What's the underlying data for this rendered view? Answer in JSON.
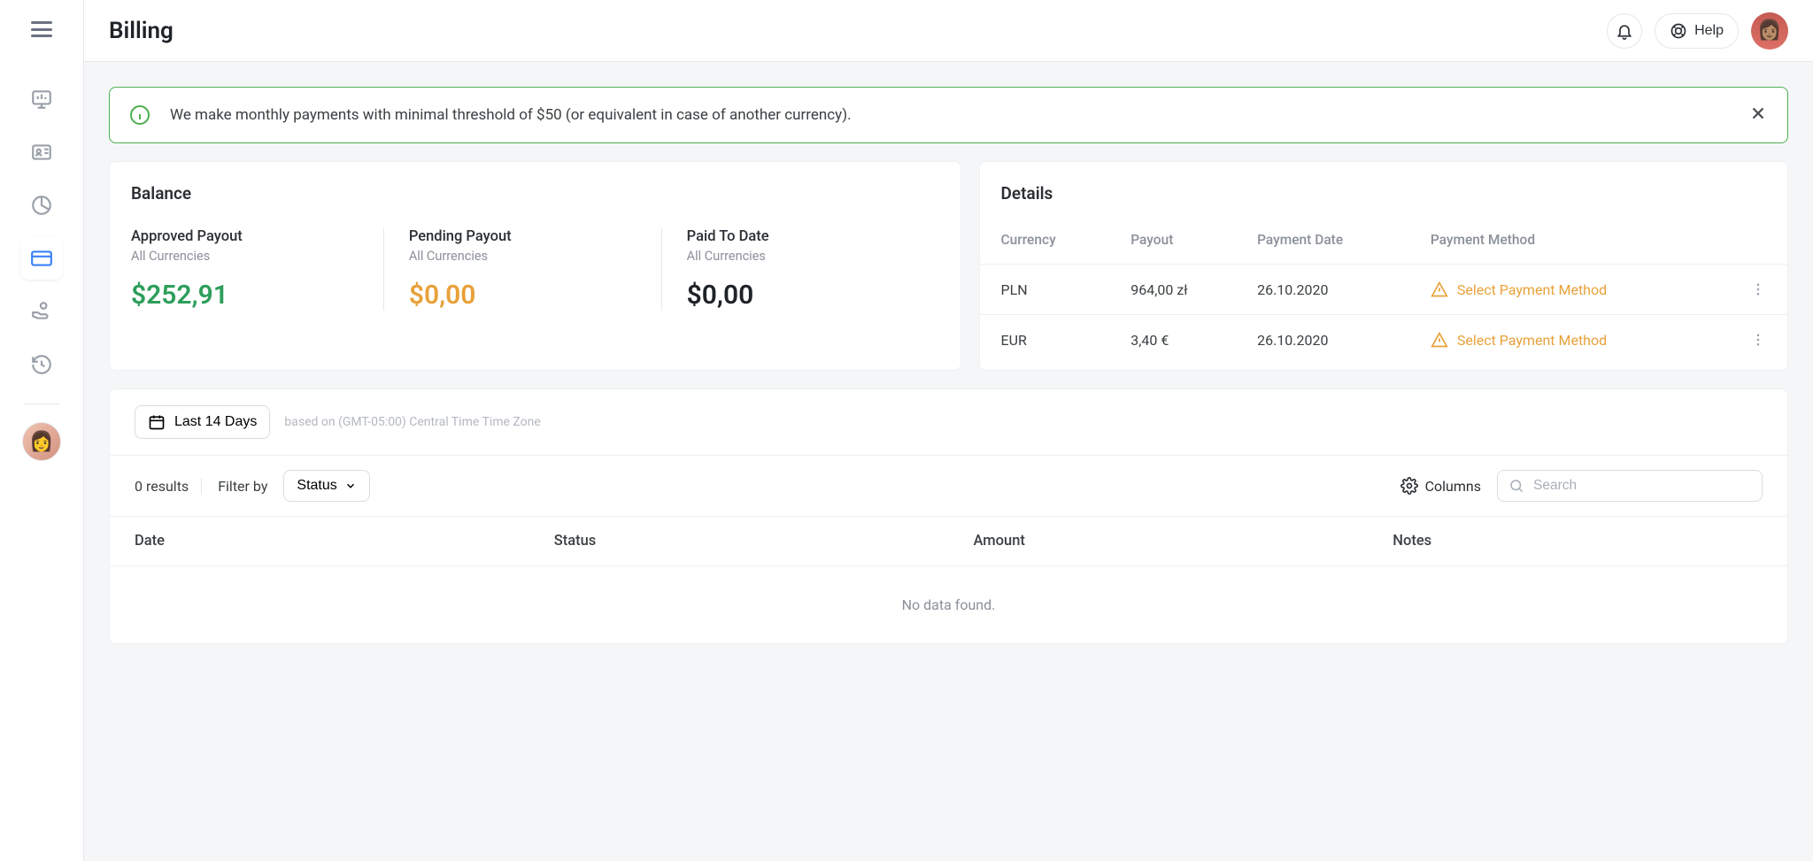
{
  "header": {
    "title": "Billing",
    "help_label": "Help"
  },
  "alert": {
    "text": "We make monthly payments with minimal threshold of $50 (or equivalent in case of another currency)."
  },
  "balance": {
    "title": "Balance",
    "approved": {
      "label": "Approved Payout",
      "sub": "All Currencies",
      "value": "$252,91"
    },
    "pending": {
      "label": "Pending Payout",
      "sub": "All Currencies",
      "value": "$0,00"
    },
    "paid": {
      "label": "Paid To Date",
      "sub": "All Currencies",
      "value": "$0,00"
    }
  },
  "details": {
    "title": "Details",
    "headers": {
      "currency": "Currency",
      "payout": "Payout",
      "date": "Payment Date",
      "method": "Payment Method"
    },
    "rows": [
      {
        "currency": "PLN",
        "payout": "964,00 zł",
        "date": "26.10.2020",
        "method": "Select Payment Method"
      },
      {
        "currency": "EUR",
        "payout": "3,40 €",
        "date": "26.10.2020",
        "method": "Select Payment Method"
      }
    ]
  },
  "filters": {
    "date_range": "Last 14 Days",
    "timezone": "based on (GMT-05:00) Central Time Time Zone",
    "results": "0 results",
    "filter_by": "Filter by",
    "status": "Status",
    "columns": "Columns",
    "search_placeholder": "Search"
  },
  "data_table": {
    "headers": {
      "date": "Date",
      "status": "Status",
      "amount": "Amount",
      "notes": "Notes"
    },
    "empty": "No data found."
  }
}
